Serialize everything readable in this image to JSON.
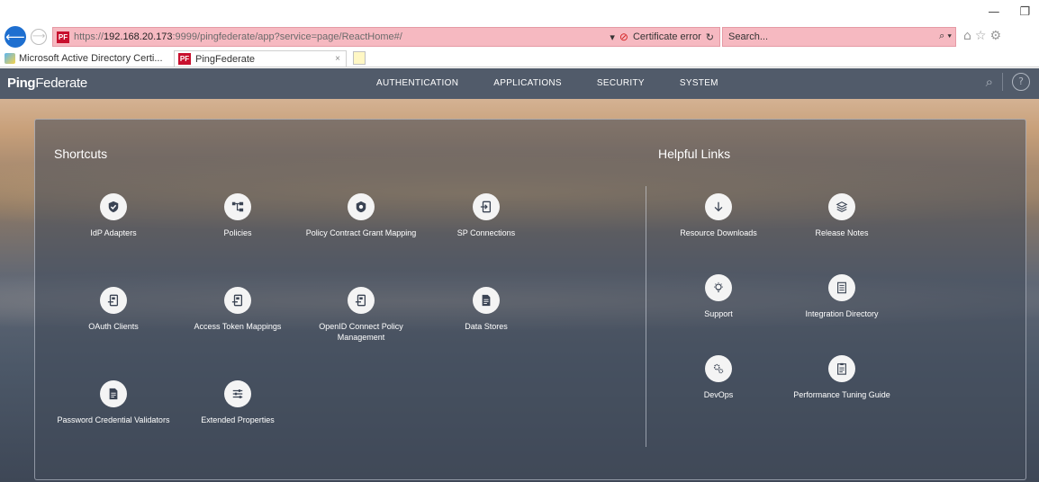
{
  "window": {
    "minimize_glyph": "—",
    "restore_glyph": "❐"
  },
  "browser": {
    "url_scheme": "https://",
    "url_host": "192.168.20.173",
    "url_rest": ":9999/pingfederate/app?service=page/ReactHome#/",
    "dropdown_glyph": "▾",
    "cert_icon_glyph": "⊘",
    "certificate_error": "Certificate error",
    "refresh_glyph": "↻",
    "search_placeholder": "Search...",
    "search_icon_glyph": "⌕ ▾",
    "toolbar_icons": [
      "home-icon",
      "favorites-star-icon",
      "settings-gear-icon"
    ],
    "toolbar_glyphs": {
      "home": "⌂",
      "star": "☆",
      "gear": "⚙"
    },
    "back_glyph": "⟵",
    "forward_glyph": "⟶",
    "favicon_text": "PF",
    "tabs": [
      {
        "label": "Microsoft Active Directory Certi..."
      },
      {
        "label": "PingFederate",
        "close": "×"
      }
    ]
  },
  "app": {
    "brand_bold": "Ping",
    "brand_rest": "Federate",
    "nav": [
      "AUTHENTICATION",
      "APPLICATIONS",
      "SECURITY",
      "SYSTEM"
    ],
    "search_glyph": "⌕",
    "help_glyph": "?"
  },
  "shortcuts": {
    "title": "Shortcuts",
    "items": [
      {
        "label": "IdP Adapters",
        "icon": "shield-check-icon"
      },
      {
        "label": "Policies",
        "icon": "policy-tree-icon"
      },
      {
        "label": "Policy Contract Grant Mapping",
        "icon": "shield-badge-icon"
      },
      {
        "label": "SP Connections",
        "icon": "connection-icon"
      },
      {
        "label": "OAuth Clients",
        "icon": "oauth-client-icon"
      },
      {
        "label": "Access Token Mappings",
        "icon": "token-mapping-icon"
      },
      {
        "label": "OpenID Connect Policy Management",
        "icon": "openid-icon"
      },
      {
        "label": "Data Stores",
        "icon": "data-store-icon"
      },
      {
        "label": "Password Credential Validators",
        "icon": "document-icon"
      },
      {
        "label": "Extended Properties",
        "icon": "sliders-icon"
      }
    ]
  },
  "helpful_links": {
    "title": "Helpful Links",
    "items": [
      {
        "label": "Resource Downloads",
        "icon": "download-arrow-icon"
      },
      {
        "label": "Release Notes",
        "icon": "layers-icon"
      },
      {
        "label": "Support",
        "icon": "lightbulb-icon"
      },
      {
        "label": "Integration Directory",
        "icon": "directory-icon"
      },
      {
        "label": "DevOps",
        "icon": "gears-icon"
      },
      {
        "label": "Performance Tuning Guide",
        "icon": "guide-icon"
      }
    ]
  },
  "colors": {
    "header": "#515b6a",
    "address_bar_error": "#f6b9c1",
    "back_button": "#1e6fd0",
    "favicon": "#c8102e"
  }
}
